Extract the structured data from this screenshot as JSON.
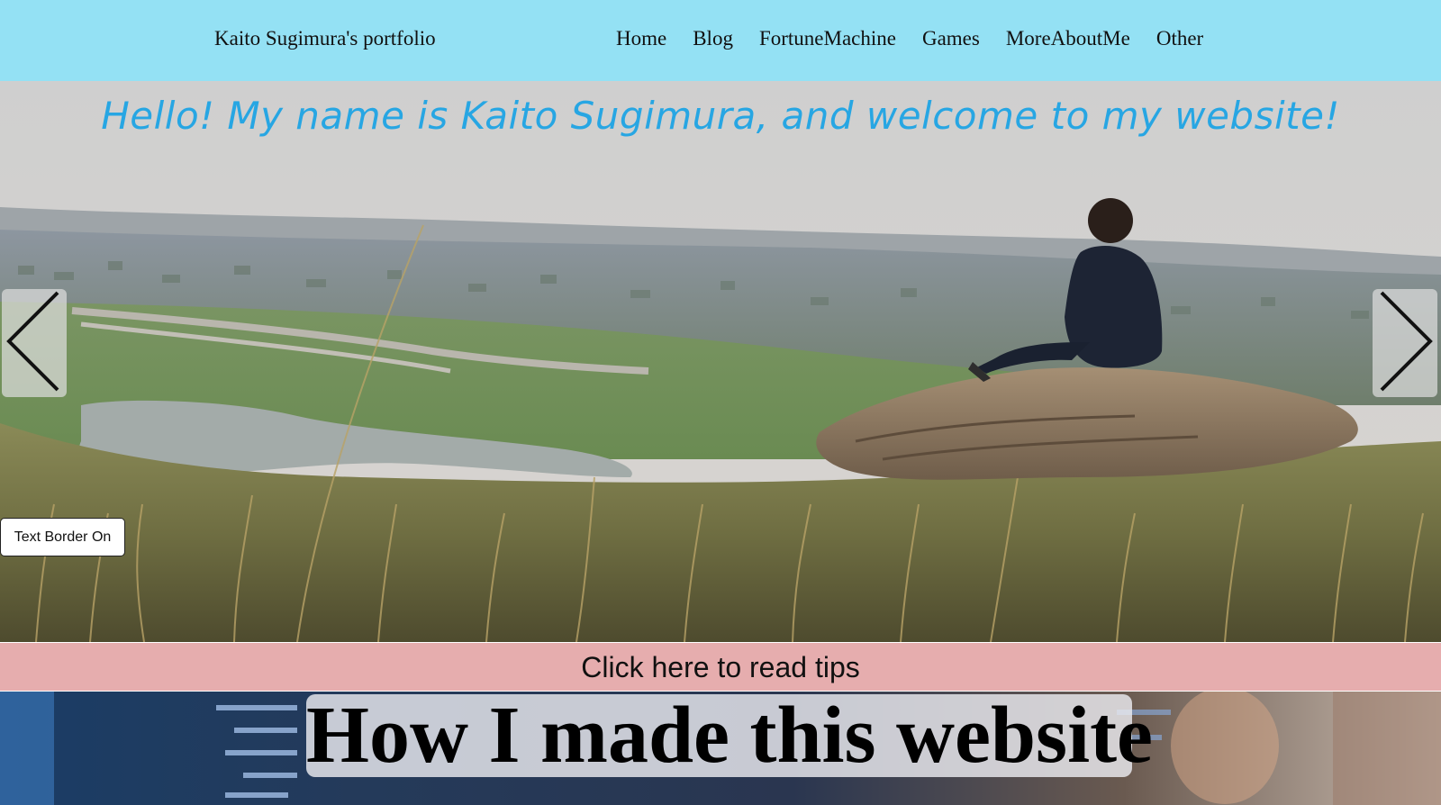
{
  "header": {
    "site_title": "Kaito Sugimura's portfolio",
    "nav": [
      "Home",
      "Blog",
      "FortuneMachine",
      "Games",
      "MoreAboutMe",
      "Other"
    ]
  },
  "hero": {
    "heading": "Hello! My name is Kaito Sugimura, and welcome to my website!",
    "prev_icon": "chevron-left-icon",
    "next_icon": "chevron-right-icon",
    "border_toggle_label": "Text Border On"
  },
  "tips": {
    "label": "Click here to read tips"
  },
  "section": {
    "title": "How I made this website"
  },
  "colors": {
    "nav_bg": "#94e1f4",
    "heading": "#27a6e3",
    "tips_bg": "#e6adae"
  }
}
